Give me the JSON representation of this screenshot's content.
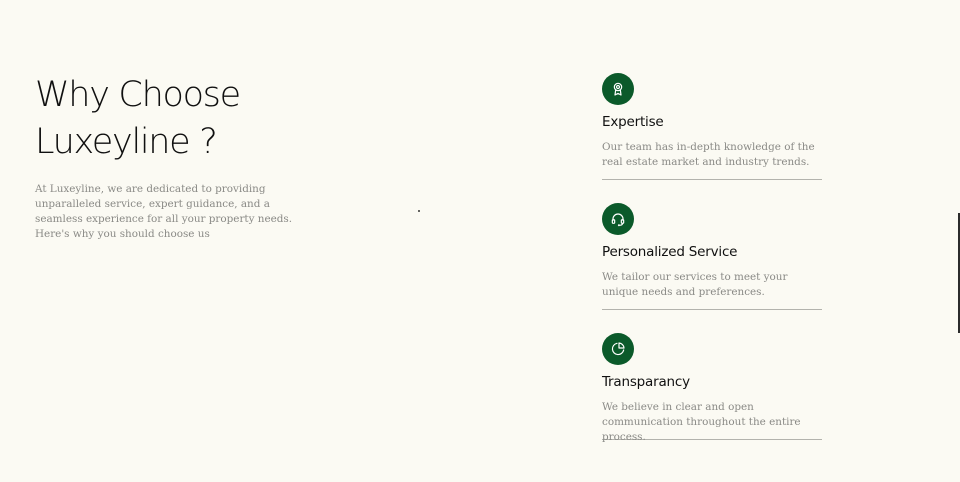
{
  "intro": {
    "headline_line1": "Why Choose",
    "headline_line2": "Luxeyline ?",
    "description": "At Luxeyline, we are dedicated to providing unparalleled service, expert guidance, and a seamless experience for all your property needs. Here's why you should choose us"
  },
  "features": [
    {
      "icon": "award-ribbon-icon",
      "title": "Expertise",
      "text": "Our team has in-depth knowledge of the real estate market and industry trends."
    },
    {
      "icon": "headset-icon",
      "title": "Personalized Service",
      "text": "We tailor our services to meet your unique needs and preferences."
    },
    {
      "icon": "pie-chart-icon",
      "title": "Transparancy",
      "text": "We believe in clear and open communication throughout the entire process."
    }
  ],
  "colors": {
    "background": "#fbfaf3",
    "accent_green": "#0b5a2a",
    "body_text": "#8a8a86",
    "heading_text": "#101010"
  }
}
